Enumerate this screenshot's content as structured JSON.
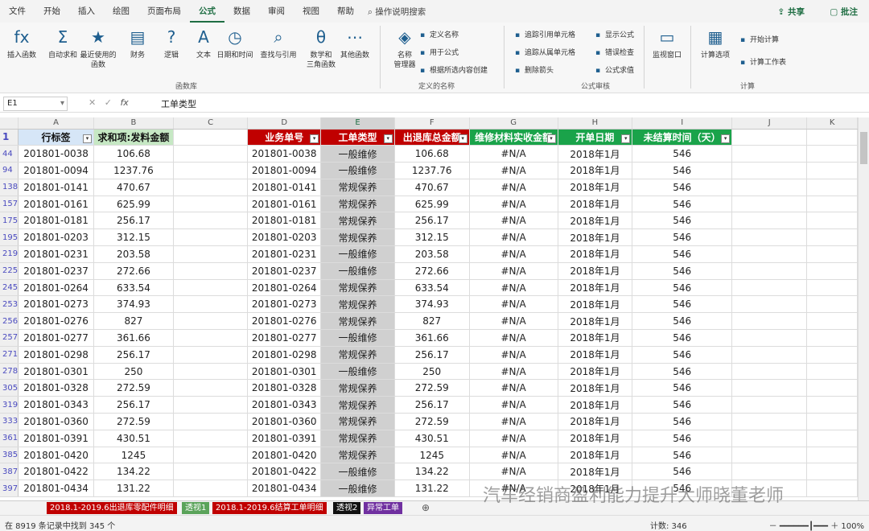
{
  "menu": {
    "tabs": [
      "文件",
      "开始",
      "插入",
      "绘图",
      "页面布局",
      "公式",
      "数据",
      "审阅",
      "视图",
      "帮助"
    ],
    "active": "公式",
    "search": "操作说明搜索",
    "share": "共享",
    "comment": "批注"
  },
  "ribbon": {
    "big": [
      {
        "name": "insert-function",
        "icon": "fx",
        "label": "插入函数"
      },
      {
        "name": "autosum",
        "icon": "Σ",
        "label": "自动求和"
      },
      {
        "name": "recent",
        "icon": "★",
        "label": "最近使用的\n函数"
      },
      {
        "name": "financial",
        "icon": "▤",
        "label": "财务"
      },
      {
        "name": "logical",
        "icon": "?",
        "label": "逻辑"
      },
      {
        "name": "text",
        "icon": "A",
        "label": "文本"
      },
      {
        "name": "datetime",
        "icon": "◷",
        "label": "日期和时间"
      },
      {
        "name": "lookup",
        "icon": "⌕",
        "label": "查找与引用"
      },
      {
        "name": "math",
        "icon": "θ",
        "label": "数学和\n三角函数"
      },
      {
        "name": "more",
        "icon": "⋯",
        "label": "其他函数"
      },
      {
        "name": "name-manager",
        "icon": "◈",
        "label": "名称\n管理器"
      },
      {
        "name": "watch",
        "icon": "▭",
        "label": "监视窗口"
      },
      {
        "name": "calc-options",
        "icon": "▦",
        "label": "计算选项"
      }
    ],
    "small": [
      {
        "name": "define-name",
        "label": "定义名称"
      },
      {
        "name": "use-in-formula",
        "label": "用于公式"
      },
      {
        "name": "create-from-selection",
        "label": "根据所选内容创建"
      },
      {
        "name": "trace-precedents",
        "label": "追踪引用单元格"
      },
      {
        "name": "trace-dependents",
        "label": "追踪从属单元格"
      },
      {
        "name": "remove-arrows",
        "label": "删除箭头"
      },
      {
        "name": "show-formulas",
        "label": "显示公式"
      },
      {
        "name": "error-check",
        "label": "错误检查"
      },
      {
        "name": "evaluate",
        "label": "公式求值"
      },
      {
        "name": "calc-now",
        "label": "开始计算"
      },
      {
        "name": "calc-sheet",
        "label": "计算工作表"
      }
    ],
    "groups": [
      "函数库",
      "定义的名称",
      "公式审核",
      "计算"
    ]
  },
  "formula_bar": {
    "cell": "E1",
    "content": "工单类型"
  },
  "columns": [
    "A",
    "B",
    "C",
    "D",
    "E",
    "F",
    "G",
    "H",
    "I",
    "J",
    "K"
  ],
  "headers": [
    "行标签",
    "求和项:发料金额",
    "",
    "业务单号",
    "工单类型",
    "出退库总金额",
    "维修材料实收金额",
    "开单日期",
    "未结算时间（天）",
    "",
    ""
  ],
  "rows": [
    {
      "r": "44",
      "c": [
        "201801-0038",
        "106.68",
        "",
        "201801-0038",
        "一般维修",
        "106.68",
        "#N/A",
        "2018年1月",
        "546",
        "",
        ""
      ]
    },
    {
      "r": "94",
      "c": [
        "201801-0094",
        "1237.76",
        "",
        "201801-0094",
        "一般维修",
        "1237.76",
        "#N/A",
        "2018年1月",
        "546",
        "",
        ""
      ]
    },
    {
      "r": "138",
      "c": [
        "201801-0141",
        "470.67",
        "",
        "201801-0141",
        "常规保养",
        "470.67",
        "#N/A",
        "2018年1月",
        "546",
        "",
        ""
      ]
    },
    {
      "r": "157",
      "c": [
        "201801-0161",
        "625.99",
        "",
        "201801-0161",
        "常规保养",
        "625.99",
        "#N/A",
        "2018年1月",
        "546",
        "",
        ""
      ]
    },
    {
      "r": "175",
      "c": [
        "201801-0181",
        "256.17",
        "",
        "201801-0181",
        "常规保养",
        "256.17",
        "#N/A",
        "2018年1月",
        "546",
        "",
        ""
      ]
    },
    {
      "r": "195",
      "c": [
        "201801-0203",
        "312.15",
        "",
        "201801-0203",
        "常规保养",
        "312.15",
        "#N/A",
        "2018年1月",
        "546",
        "",
        ""
      ]
    },
    {
      "r": "219",
      "c": [
        "201801-0231",
        "203.58",
        "",
        "201801-0231",
        "一般维修",
        "203.58",
        "#N/A",
        "2018年1月",
        "546",
        "",
        ""
      ]
    },
    {
      "r": "225",
      "c": [
        "201801-0237",
        "272.66",
        "",
        "201801-0237",
        "一般维修",
        "272.66",
        "#N/A",
        "2018年1月",
        "546",
        "",
        ""
      ]
    },
    {
      "r": "245",
      "c": [
        "201801-0264",
        "633.54",
        "",
        "201801-0264",
        "常规保养",
        "633.54",
        "#N/A",
        "2018年1月",
        "546",
        "",
        ""
      ]
    },
    {
      "r": "253",
      "c": [
        "201801-0273",
        "374.93",
        "",
        "201801-0273",
        "常规保养",
        "374.93",
        "#N/A",
        "2018年1月",
        "546",
        "",
        ""
      ]
    },
    {
      "r": "256",
      "c": [
        "201801-0276",
        "827",
        "",
        "201801-0276",
        "常规保养",
        "827",
        "#N/A",
        "2018年1月",
        "546",
        "",
        ""
      ]
    },
    {
      "r": "257",
      "c": [
        "201801-0277",
        "361.66",
        "",
        "201801-0277",
        "一般维修",
        "361.66",
        "#N/A",
        "2018年1月",
        "546",
        "",
        ""
      ]
    },
    {
      "r": "271",
      "c": [
        "201801-0298",
        "256.17",
        "",
        "201801-0298",
        "常规保养",
        "256.17",
        "#N/A",
        "2018年1月",
        "546",
        "",
        ""
      ]
    },
    {
      "r": "278",
      "c": [
        "201801-0301",
        "250",
        "",
        "201801-0301",
        "一般维修",
        "250",
        "#N/A",
        "2018年1月",
        "546",
        "",
        ""
      ]
    },
    {
      "r": "305",
      "c": [
        "201801-0328",
        "272.59",
        "",
        "201801-0328",
        "常规保养",
        "272.59",
        "#N/A",
        "2018年1月",
        "546",
        "",
        ""
      ]
    },
    {
      "r": "319",
      "c": [
        "201801-0343",
        "256.17",
        "",
        "201801-0343",
        "常规保养",
        "256.17",
        "#N/A",
        "2018年1月",
        "546",
        "",
        ""
      ]
    },
    {
      "r": "333",
      "c": [
        "201801-0360",
        "272.59",
        "",
        "201801-0360",
        "常规保养",
        "272.59",
        "#N/A",
        "2018年1月",
        "546",
        "",
        ""
      ]
    },
    {
      "r": "361",
      "c": [
        "201801-0391",
        "430.51",
        "",
        "201801-0391",
        "常规保养",
        "430.51",
        "#N/A",
        "2018年1月",
        "546",
        "",
        ""
      ]
    },
    {
      "r": "385",
      "c": [
        "201801-0420",
        "1245",
        "",
        "201801-0420",
        "常规保养",
        "1245",
        "#N/A",
        "2018年1月",
        "546",
        "",
        ""
      ]
    },
    {
      "r": "387",
      "c": [
        "201801-0422",
        "134.22",
        "",
        "201801-0422",
        "一般维修",
        "134.22",
        "#N/A",
        "2018年1月",
        "546",
        "",
        ""
      ]
    },
    {
      "r": "397",
      "c": [
        "201801-0434",
        "131.22",
        "",
        "201801-0434",
        "一般维修",
        "131.22",
        "#N/A",
        "2018年1月",
        "546",
        "",
        ""
      ]
    }
  ],
  "sheets": [
    {
      "label": "2018.1-2019.6出退库零配件明细",
      "color": "#c00000"
    },
    {
      "label": "透视1",
      "color": "#5aa35a"
    },
    {
      "label": "2018.1-2019.6结算工单明细",
      "color": "#c00000"
    },
    {
      "label": "透视2",
      "color": "#111111"
    },
    {
      "label": "异常工单",
      "color": "#7030a0"
    }
  ],
  "status": {
    "left": "在 8919 条记录中找到 345 个",
    "count": "计数: 346",
    "zoom": "100%"
  },
  "watermark": "汽车经销商盈利能力提升大师晓董老师"
}
